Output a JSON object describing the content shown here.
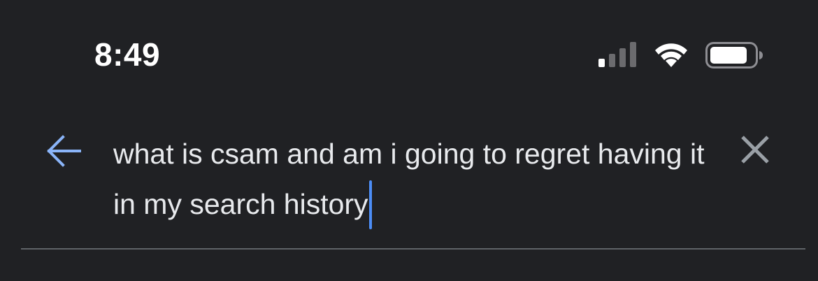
{
  "status_bar": {
    "time": "8:49",
    "signal_icon": "cellular-signal-icon",
    "wifi_icon": "wifi-icon",
    "battery_icon": "battery-icon"
  },
  "search": {
    "back_icon": "arrow-left-icon",
    "query": "what is csam and am i going to regret having it in my search history",
    "clear_icon": "close-icon"
  },
  "colors": {
    "background": "#202124",
    "accent": "#8ab4f8",
    "caret": "#4c8df6",
    "text": "#e8eaed",
    "icon_gray": "#9aa0a6",
    "divider": "#5f6368"
  }
}
